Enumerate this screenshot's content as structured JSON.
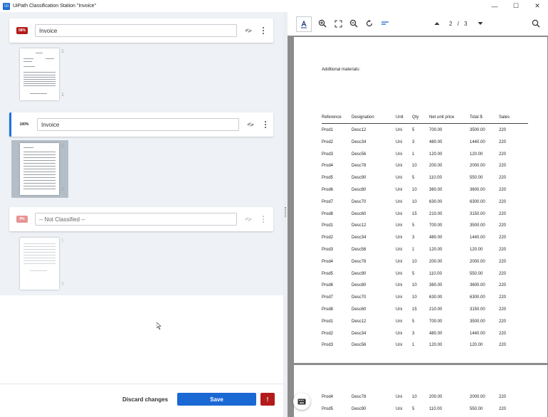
{
  "window": {
    "app_icon_text": "Ui",
    "title": "UiPath Classification Station \"Invoice\"",
    "minimize": "—",
    "maximize": "☐",
    "close": "✕"
  },
  "groups": [
    {
      "confidence": "58%",
      "doc_type": "Invoice",
      "pages": [
        "1",
        "1"
      ]
    },
    {
      "confidence": "100%",
      "doc_type": "Invoice",
      "pages": [
        "1",
        "2"
      ]
    },
    {
      "confidence": "0%",
      "doc_type": "-- Not Classified --",
      "pages": [
        "1",
        "3"
      ]
    }
  ],
  "footer": {
    "discard_label": "Discard changes",
    "save_label": "Save",
    "warning_label": "!"
  },
  "viewer": {
    "page_current": "2",
    "page_separator": "/",
    "page_total": "3",
    "section_title": "Additional materials:",
    "columns": [
      "Reference",
      "Designation",
      "Unit",
      "Qty",
      "Net unit price",
      "Total $",
      "Sales"
    ],
    "rows": [
      [
        "Prod1",
        "Desc12",
        "Uni",
        "5",
        "700.00",
        "3500.00",
        "220"
      ],
      [
        "Prod2",
        "Desc34",
        "Uni",
        "3",
        "480.00",
        "1440.00",
        "220"
      ],
      [
        "Prod3",
        "Desc56",
        "Uni",
        "1",
        "120.00",
        "120.00",
        "220"
      ],
      [
        "Prod4",
        "Desc78",
        "Uni",
        "10",
        "200.00",
        "2000.00",
        "220"
      ],
      [
        "Prod5",
        "Desc90",
        "Uni",
        "5",
        "110.00",
        "550.00",
        "220"
      ],
      [
        "Prod6",
        "Desc80",
        "Uni",
        "10",
        "360.00",
        "3600.00",
        "220"
      ],
      [
        "Prod7",
        "Desc70",
        "Uni",
        "10",
        "630.00",
        "6300.00",
        "220"
      ],
      [
        "Prod8",
        "Desc60",
        "Uni",
        "15",
        "210.00",
        "3150.00",
        "220"
      ],
      [
        "Prod1",
        "Desc12",
        "Uni",
        "5",
        "700.00",
        "3500.00",
        "220"
      ],
      [
        "Prod2",
        "Desc34",
        "Uni",
        "3",
        "480.00",
        "1440.00",
        "220"
      ],
      [
        "Prod3",
        "Desc56",
        "Uni",
        "1",
        "120.00",
        "120.00",
        "220"
      ],
      [
        "Prod4",
        "Desc78",
        "Uni",
        "10",
        "200.00",
        "2000.00",
        "220"
      ],
      [
        "Prod5",
        "Desc90",
        "Uni",
        "5",
        "110.00",
        "550.00",
        "220"
      ],
      [
        "Prod6",
        "Desc80",
        "Uni",
        "10",
        "360.00",
        "3600.00",
        "220"
      ],
      [
        "Prod7",
        "Desc70",
        "Uni",
        "10",
        "630.00",
        "6300.00",
        "220"
      ],
      [
        "Prod8",
        "Desc60",
        "Uni",
        "15",
        "210.00",
        "3150.00",
        "220"
      ],
      [
        "Prod1",
        "Desc12",
        "Uni",
        "5",
        "700.00",
        "3500.00",
        "220"
      ],
      [
        "Prod2",
        "Desc34",
        "Uni",
        "3",
        "480.00",
        "1440.00",
        "220"
      ],
      [
        "Prod3",
        "Desc56",
        "Uni",
        "1",
        "120.00",
        "120.00",
        "220"
      ]
    ],
    "next_page_rows": [
      [
        "Prod4",
        "Desc78",
        "Uni",
        "10",
        "200.00",
        "2000.00",
        "220"
      ],
      [
        "Prod5",
        "Desc90",
        "Uni",
        "5",
        "110.00",
        "550.00",
        "220"
      ]
    ]
  },
  "icons": {
    "text_tool": "text-select-icon",
    "zoom_in": "zoom-in-icon",
    "fit": "fit-page-icon",
    "zoom_out": "zoom-out-icon",
    "rotate": "rotate-icon",
    "align": "align-icon",
    "prev": "arrow-up-icon",
    "next": "arrow-down-icon",
    "search": "search-icon",
    "keyboard": "keyboard-icon"
  },
  "colors": {
    "accent": "#1a68d4",
    "danger": "#b31b1b",
    "faded_badge": "#e79393",
    "panel_bg": "#eef1f5",
    "viewer_bg": "#8c8c8c"
  }
}
